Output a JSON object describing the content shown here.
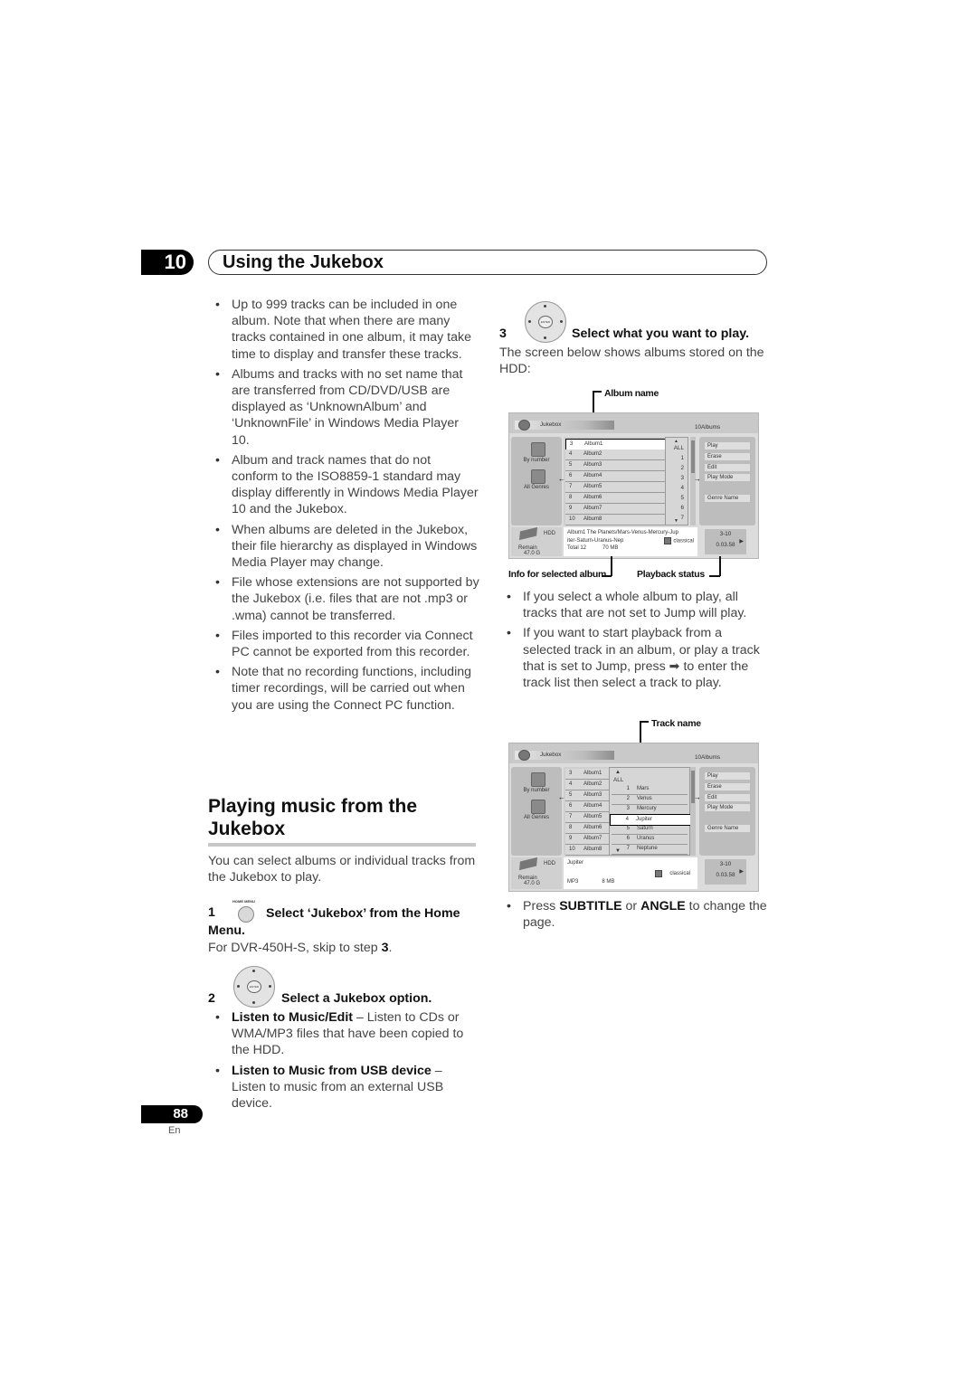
{
  "chapter": {
    "number": "10",
    "title": "Using the Jukebox"
  },
  "left_bullets": [
    "Up to 999 tracks can be included in one album. Note that when there are many tracks contained in one album, it may take time to display and transfer these tracks.",
    "Albums and tracks with no set name that are transferred from CD/DVD/USB are displayed as ‘UnknownAlbum’ and ‘UnknownFile’ in Windows Media Player 10.",
    "Album and track names that do not conform to the ISO8859-1 standard may display differently in Windows Media Player 10 and the Jukebox.",
    "When albums are deleted in the Jukebox, their file hierarchy as displayed in Windows Media Player may change.",
    "File whose extensions are not supported by the Jukebox (i.e. files that are not .mp3 or .wma) cannot be transferred.",
    "Files imported to this recorder via Connect PC cannot be exported from this recorder.",
    "Note that no recording functions, including timer recordings, will be carried out when you are using the Connect PC function."
  ],
  "section": {
    "title": "Playing music from the Jukebox",
    "intro": "You can select albums or individual tracks from the Jukebox to play."
  },
  "steps": {
    "step1": {
      "number": "1",
      "button_label": "HOME MENU",
      "text": "Select ‘Jukebox’ from the Home Menu.",
      "note_prefix": "For DVR-450H-S, skip to step ",
      "note_step": "3",
      "note_suffix": "."
    },
    "step2": {
      "number": "2",
      "button_label": "ENTER",
      "text": "Select a Jukebox option.",
      "options": [
        {
          "bold": "Listen to Music/Edit",
          "text": " – Listen to CDs or WMA/MP3 files that have been copied to the HDD."
        },
        {
          "bold": "Listen to Music from USB device",
          "text": " – Listen to music from an external USB device."
        }
      ]
    },
    "step3": {
      "number": "3",
      "button_label": "ENTER",
      "text": "Select what you want to play.",
      "note": "The screen below shows albums stored on the HDD:"
    }
  },
  "screen1": {
    "callouts": {
      "album_name": "Album name",
      "info": "Info for selected album",
      "playback": "Playback status"
    },
    "title": "Jukebox",
    "count": "10Albums",
    "left": {
      "by_number": "By number",
      "all_genres": "All Genres",
      "hdd": "HDD",
      "remain_label": "Remain",
      "remain_value": "47.0 G"
    },
    "albums": [
      {
        "n": "3",
        "name": "Album1",
        "selected": true
      },
      {
        "n": "4",
        "name": "Album2"
      },
      {
        "n": "5",
        "name": "Album3"
      },
      {
        "n": "6",
        "name": "Album4"
      },
      {
        "n": "7",
        "name": "Album5"
      },
      {
        "n": "8",
        "name": "Album6"
      },
      {
        "n": "9",
        "name": "Album7"
      },
      {
        "n": "10",
        "name": "Album8"
      }
    ],
    "numbers": [
      "ALL",
      "1",
      "2",
      "3",
      "4",
      "5",
      "6",
      "7"
    ],
    "menu": [
      "Play",
      "Erase",
      "Edit",
      "Play Mode",
      "Genre Name"
    ],
    "info": {
      "line1": "Album1  The Planets/Mars-Venus-Mercury-Jup",
      "line2": "iter-Saturn-Uranus-Nep",
      "genre": "classical",
      "total": "Total 12",
      "size": "70 MB"
    },
    "playback": {
      "track": "3-10",
      "time": "0.03.58"
    }
  },
  "mid_bullets": [
    "If you select a whole album to play, all tracks that are not set to Jump will play.",
    "If you want to start playback from a selected track in an album, or play a track that is set to Jump, press ➡ to enter the track list then select a track to play."
  ],
  "screen2": {
    "callouts": {
      "track_name": "Track name"
    },
    "title": "Jukebox",
    "count": "10Albums",
    "left": {
      "by_number": "By number",
      "all_genres": "All Genres",
      "hdd": "HDD",
      "remain_label": "Remain",
      "remain_value": "47.0 G"
    },
    "albums": [
      {
        "n": "3",
        "name": "Album1"
      },
      {
        "n": "4",
        "name": "Album2"
      },
      {
        "n": "5",
        "name": "Album3"
      },
      {
        "n": "6",
        "name": "Album4"
      },
      {
        "n": "7",
        "name": "Album5"
      },
      {
        "n": "8",
        "name": "Album6"
      },
      {
        "n": "9",
        "name": "Album7"
      },
      {
        "n": "10",
        "name": "Album8"
      }
    ],
    "all_label": "ALL",
    "tracks": [
      {
        "n": "1",
        "name": "Mars"
      },
      {
        "n": "2",
        "name": "Venus"
      },
      {
        "n": "3",
        "name": "Mercury"
      },
      {
        "n": "4",
        "name": "Jupiter",
        "selected": true
      },
      {
        "n": "5",
        "name": "Saturn"
      },
      {
        "n": "6",
        "name": "Uranus"
      },
      {
        "n": "7",
        "name": "Neptune"
      }
    ],
    "menu": [
      "Play",
      "Erase",
      "Edit",
      "Play Mode",
      "Genre Name"
    ],
    "info": {
      "title": "Jupiter",
      "format": "MP3",
      "size": "8 MB",
      "genre": "classical"
    },
    "playback": {
      "track": "3-10",
      "time": "0.03.58"
    }
  },
  "last_bullet": {
    "prefix": "Press ",
    "b1": "SUBTITLE",
    "mid": " or ",
    "b2": "ANGLE",
    "suffix": " to change the page."
  },
  "footer": {
    "page": "88",
    "lang": "En"
  }
}
